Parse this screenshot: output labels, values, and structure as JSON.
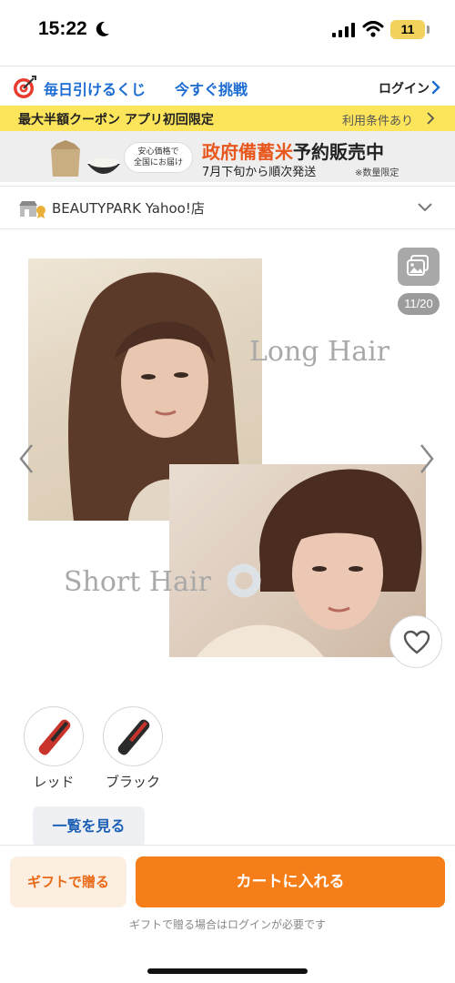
{
  "status_bar": {
    "time": "15:22",
    "battery": "11"
  },
  "top_nav": {
    "lottery": "毎日引けるくじ",
    "challenge": "今すぐ挑戦",
    "login": "ログイン"
  },
  "coupon_bar": {
    "text": "最大半額クーポン アプリ初回限定",
    "terms": "利用条件あり"
  },
  "rice_banner": {
    "badge_line1": "安心価格で",
    "badge_line2": "全国にお届け",
    "title_highlight": "政府備蓄米",
    "title_rest": "予約販売中",
    "subtitle": "7月下旬から順次発送",
    "note": "※数量限定"
  },
  "store": {
    "name": "BEAUTYPARK Yahoo!店"
  },
  "gallery": {
    "label_long": "Long Hair",
    "label_short": "Short Hair",
    "counter": "11/20"
  },
  "variants": [
    {
      "label": "レッド",
      "color": "#c8342c"
    },
    {
      "label": "ブラック",
      "color": "#2a2a2a"
    }
  ],
  "view_all": "一覧を見る",
  "bottom": {
    "gift_button": "ギフトで贈る",
    "cart_button": "カートに入れる",
    "gift_note": "ギフトで贈る場合はログインが必要です"
  },
  "colors": {
    "accent_blue": "#1a6bd1",
    "cart_orange": "#f57e19",
    "coupon_yellow": "#fce55a"
  }
}
